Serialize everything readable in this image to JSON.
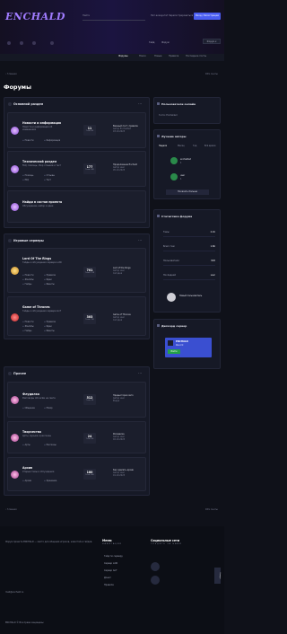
{
  "site": {
    "logo": "ENCHALD"
  },
  "header": {
    "search_placeholder": "Найти",
    "account_text": "Нет аккаунта? Зарегистрироваться",
    "login_btn": "Вход / Регистрация",
    "nav": [
      "Гайд",
      "Форум"
    ],
    "nav_btn": "Форум ▾"
  },
  "subnav": [
    "Форумы",
    "Поиск",
    "Новые",
    "Правила",
    "Последние посты"
  ],
  "breadcrumbs": {
    "left": "‹ Главная",
    "right": "RSS ленты"
  },
  "page_title": "Форумы",
  "categories": [
    {
      "title": "Основной раздел",
      "forums": [
        {
          "title": "Новости и информация",
          "desc": "Новости и информация об изменениях",
          "subs": [
            "Новости",
            "Информация"
          ],
          "stat_n": "11",
          "stat_l": "Темы: 43",
          "last_title": "Важный пост: правила",
          "last_user": "Автор Enchalded",
          "last_time": "03.10.2023"
        },
        {
          "title": "Технический раздел",
          "desc": "FAQ, помощь, сбор отзывов и тест",
          "subs": [
            "Помощь",
            "Отзывы",
            "FAQ",
            "Тест"
          ],
          "stat_n": "177",
          "stat_l": "Темы: 345",
          "last_title": "Продолжение Enchald",
          "last_user": "Автор user",
          "last_time": "05.10.2023"
        },
        {
          "title": "Найди в состав проекта",
          "desc": "Обсуждение, набор и идеи",
          "subs": [],
          "stat_n": "",
          "stat_l": "",
          "last_title": "",
          "last_user": "",
          "last_time": ""
        }
      ]
    },
    {
      "title": "Игровые серверы",
      "forums": [
        {
          "title": "Lord Of The Rings",
          "desc": "Гайды и обсуждения сервера LotR",
          "subs": [
            "Новости",
            "Правила",
            "Жалобы",
            "Идеи",
            "Гайды",
            "Ивенты"
          ],
          "stat_n": "701",
          "stat_l": "Темы: 1.5K",
          "last_title": "Lord of the Rings",
          "last_user": "Автор user",
          "last_time": "Сегодня"
        },
        {
          "title": "Game of Thrones",
          "desc": "Гайды и обсуждения сервера GoT",
          "subs": [
            "Новости",
            "Правила",
            "Жалобы",
            "Идеи",
            "Гайды",
            "Ивенты"
          ],
          "stat_n": "303",
          "stat_l": "Темы: 790",
          "last_title": "Game of Thrones",
          "last_user": "Автор user",
          "last_time": "Сегодня"
        }
      ]
    },
    {
      "title": "Прочее",
      "forums": [
        {
          "title": "Флудилка",
          "desc": "Разговоры обо всём на свете",
          "subs": [
            "Общение",
            "Юмор"
          ],
          "stat_n": "512",
          "stat_l": "Темы: 2K",
          "last_title": "Предыстория лето",
          "last_user": "Автор user",
          "last_time": "Вчера"
        },
        {
          "title": "Творчество",
          "desc": "Арты, музыка и рассказы",
          "subs": [
            "Арты",
            "Рассказы"
          ],
          "stat_n": "24",
          "stat_l": "Темы: 60",
          "last_title": "Рисовалка",
          "last_user": "Автор user",
          "last_time": "02.10.2023"
        },
        {
          "title": "Архив",
          "desc": "Старые темы и обсуждения",
          "subs": [
            "Архив",
            "Хранение"
          ],
          "stat_n": "180",
          "stat_l": "Темы: 400",
          "last_title": "Как сделать архив",
          "last_user": "Автор user",
          "last_time": "01.10.2023"
        }
      ]
    }
  ],
  "sidebar": {
    "online": {
      "title": "Пользователи онлайн",
      "users": "Гости: Enchalded"
    },
    "authors": {
      "title": "Лучшие авторы",
      "tabs": [
        "Неделя",
        "Месяц",
        "Год",
        "Всё время"
      ],
      "list": [
        {
          "name": "enchalded",
          "points": "1"
        },
        {
          "name": "user",
          "points": "1"
        }
      ],
      "btn": "Показать больше"
    },
    "stats": {
      "title": "Статистика форума",
      "rows": [
        {
          "l": "Темы",
          "v": "2.1K"
        },
        {
          "l": "Всего тем",
          "v": "1.6K"
        },
        {
          "l": "Пользователи",
          "v": "820"
        },
        {
          "l": "Последний",
          "v": "user"
        }
      ],
      "new_user": "Новый пользователь"
    },
    "dev": {
      "title": "Дискорд сервер",
      "card_title": "ENCHALD",
      "card_sub": "Discord",
      "card_btn": "Войти"
    }
  },
  "footer": {
    "about": "Форум проекта ENCHALD — место для общения игроков, новостей и гайдов.",
    "contact": "mail@enchald.ru",
    "menu_title": "Меню",
    "menu_sub": "НАВИГАЦИЯ",
    "menu": [
      "Гайд по серверу",
      "Сервер LotR",
      "Сервер GoT",
      "Донат",
      "Правила"
    ],
    "social_title": "Социальные сети",
    "social_sub": "СЛЕДИТЕ ЗА НАМИ",
    "copyright": "ENCHALD © Все права защищены",
    "side_tab": "Наверх"
  },
  "colors": {
    "accent": "#4a5df0",
    "logo": "#a07cff",
    "bg": "#0f1119",
    "card": "#161926"
  }
}
